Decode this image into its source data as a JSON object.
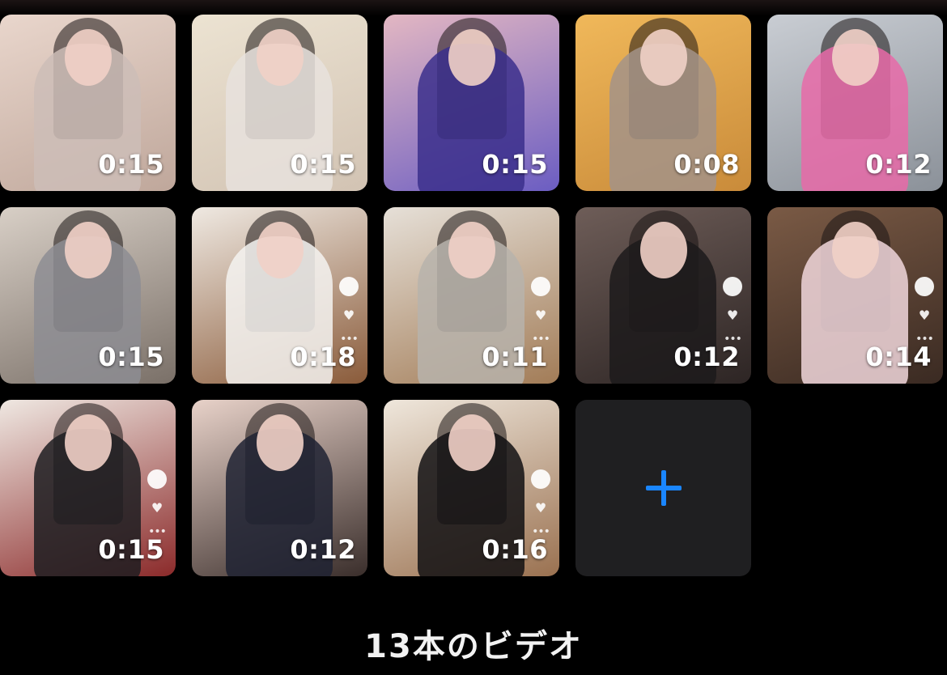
{
  "videos": [
    {
      "duration": "0:15",
      "bg": [
        "#e9d6cc",
        "#bfa79b"
      ],
      "outfit": "#cdbdb7",
      "icons": false
    },
    {
      "duration": "0:15",
      "bg": [
        "#ece3d2",
        "#d2c3b3"
      ],
      "outfit": "#e7e2dd",
      "icons": false
    },
    {
      "duration": "0:15",
      "bg": [
        "#e3b7c2",
        "#6b5dc2"
      ],
      "outfit": "#3b2f8c",
      "icons": false
    },
    {
      "duration": "0:08",
      "bg": [
        "#f0b85a",
        "#c98b3a"
      ],
      "outfit": "#a39388",
      "icons": false
    },
    {
      "duration": "0:12",
      "bg": [
        "#c9cdd3",
        "#8b9199"
      ],
      "outfit": "#e86aa8",
      "icons": false
    },
    {
      "duration": "0:15",
      "bg": [
        "#d8cfc6",
        "#7a7068"
      ],
      "outfit": "#8d8d93",
      "icons": false
    },
    {
      "duration": "0:18",
      "bg": [
        "#efe9e2",
        "#8a5b3a"
      ],
      "outfit": "#f4f3f1",
      "icons": true
    },
    {
      "duration": "0:11",
      "bg": [
        "#e6e0d8",
        "#a27c57"
      ],
      "outfit": "#b7b3ac",
      "icons": true
    },
    {
      "duration": "0:12",
      "bg": [
        "#6e5d58",
        "#2d2524"
      ],
      "outfit": "#1c1a1b",
      "icons": true
    },
    {
      "duration": "0:14",
      "bg": [
        "#7a5a45",
        "#3a2a22"
      ],
      "outfit": "#f1d7dc",
      "icons": true
    },
    {
      "duration": "0:15",
      "bg": [
        "#efe8e2",
        "#8b2a2a"
      ],
      "outfit": "#1d1d21",
      "icons": true
    },
    {
      "duration": "0:12",
      "bg": [
        "#e8d2c9",
        "#3a2e2b"
      ],
      "outfit": "#1e2233",
      "icons": false
    },
    {
      "duration": "0:16",
      "bg": [
        "#efe7dc",
        "#9a7150"
      ],
      "outfit": "#121113",
      "icons": true
    }
  ],
  "add_button": {
    "icon": "plus-icon",
    "color": "#1a86ff"
  },
  "footer": {
    "count_label": "13本のビデオ"
  }
}
